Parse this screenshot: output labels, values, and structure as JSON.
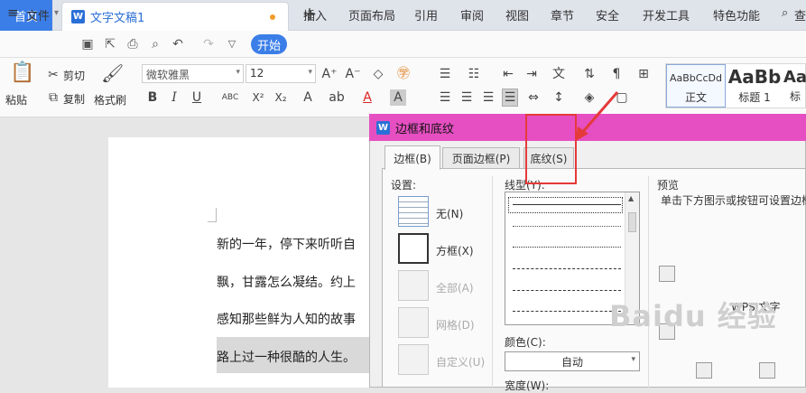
{
  "tabs": {
    "home": "首页",
    "doc": "文字文稿1",
    "new": "+"
  },
  "menu": {
    "file": "文件",
    "start": "开始",
    "items": [
      "插入",
      "页面布局",
      "引用",
      "审阅",
      "视图",
      "章节",
      "安全",
      "开发工具",
      "特色功能"
    ],
    "search": "查"
  },
  "ribbon": {
    "paste": "粘贴",
    "cut": "剪切",
    "copy": "复制",
    "format_painter": "格式刷",
    "font": "微软雅黑",
    "size": "12",
    "bold": "B",
    "italic": "I",
    "underline": "U",
    "abc": "ABC",
    "superscript": "X²",
    "subscript": "X₂"
  },
  "styles": [
    {
      "sample": "AaBbCcDd",
      "name": "正文"
    },
    {
      "sample": "AaBb",
      "name": "标题 1"
    },
    {
      "sample": "Aa",
      "name": "标"
    }
  ],
  "document": {
    "lines": [
      "新的一年，停下来听听自",
      "飘，甘露怎么凝结。约上",
      "感知那些鲜为人知的故事",
      "路上过一种很酷的人生。"
    ]
  },
  "dialog": {
    "title": "边框和底纹",
    "tabs": [
      "边框(B)",
      "页面边框(P)",
      "底纹(S)"
    ],
    "settings_label": "设置:",
    "settings": [
      "无(N)",
      "方框(X)",
      "全部(A)",
      "网格(D)",
      "自定义(U)"
    ],
    "line_style_label": "线型(Y):",
    "color_label": "颜色(C):",
    "color_value": "自动",
    "width_label": "宽度(W):",
    "preview_label": "预览",
    "preview_hint": "单击下方图示或按钮可设置边框",
    "preview_text": "WPS 文字"
  },
  "watermark": "Baidu 经验"
}
